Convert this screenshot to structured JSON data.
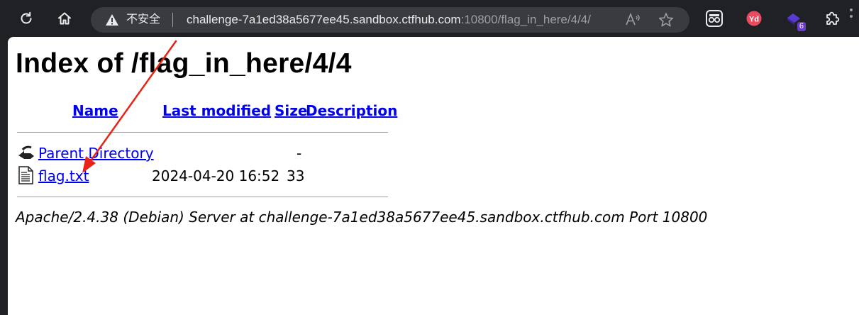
{
  "browser": {
    "security_label": "不安全",
    "url_host": "challenge-7a1ed38a5677ee45.sandbox.ctfhub.com",
    "url_path": ":10800/flag_in_here/4/4/",
    "extension_badge": "6"
  },
  "page": {
    "title": "Index of /flag_in_here/4/4",
    "columns": {
      "name": "Name",
      "last_modified": "Last modified",
      "size": "Size",
      "description": "Description"
    },
    "rows": [
      {
        "icon": "back-icon",
        "name": "Parent Directory",
        "last_modified": "",
        "size": "-",
        "description": ""
      },
      {
        "icon": "text-file-icon",
        "name": "flag.txt",
        "last_modified": "2024-04-20 16:52",
        "size": "33",
        "description": ""
      }
    ],
    "address": "Apache/2.4.38 (Debian) Server at challenge-7a1ed38a5677ee45.sandbox.ctfhub.com Port 10800"
  },
  "colors": {
    "link": "#0000ee",
    "annotation_arrow": "#e8231a",
    "toolbar_bg": "#202124",
    "omnibox_bg": "#3a3b3e"
  }
}
